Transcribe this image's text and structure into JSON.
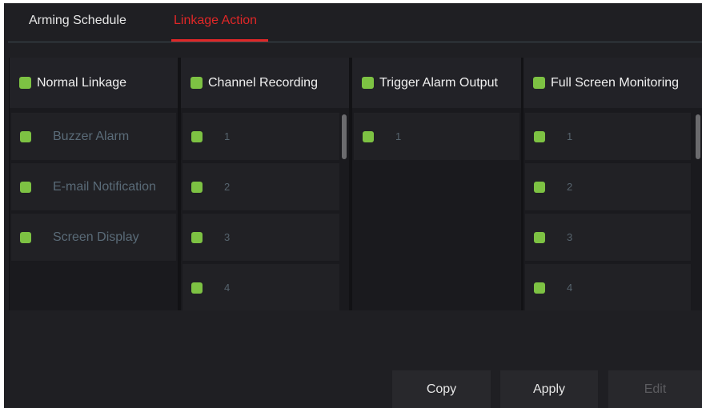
{
  "tabs": [
    {
      "label": "Arming Schedule",
      "active": false
    },
    {
      "label": "Linkage Action",
      "active": true
    }
  ],
  "colors": {
    "accent": "#e02727",
    "checkbox": "#7dc243",
    "background": "#1f1f23"
  },
  "columns": [
    {
      "title": "Normal Linkage",
      "items": [
        "Buzzer Alarm",
        "E-mail Notification",
        "Screen Display"
      ]
    },
    {
      "title": "Channel Recording",
      "items": [
        "1",
        "2",
        "3",
        "4"
      ]
    },
    {
      "title": "Trigger Alarm Output",
      "items": [
        "1"
      ]
    },
    {
      "title": "Full Screen Monitoring",
      "items": [
        "1",
        "2",
        "3",
        "4"
      ]
    }
  ],
  "buttons": {
    "copy": "Copy",
    "apply": "Apply",
    "edit": "Edit"
  }
}
